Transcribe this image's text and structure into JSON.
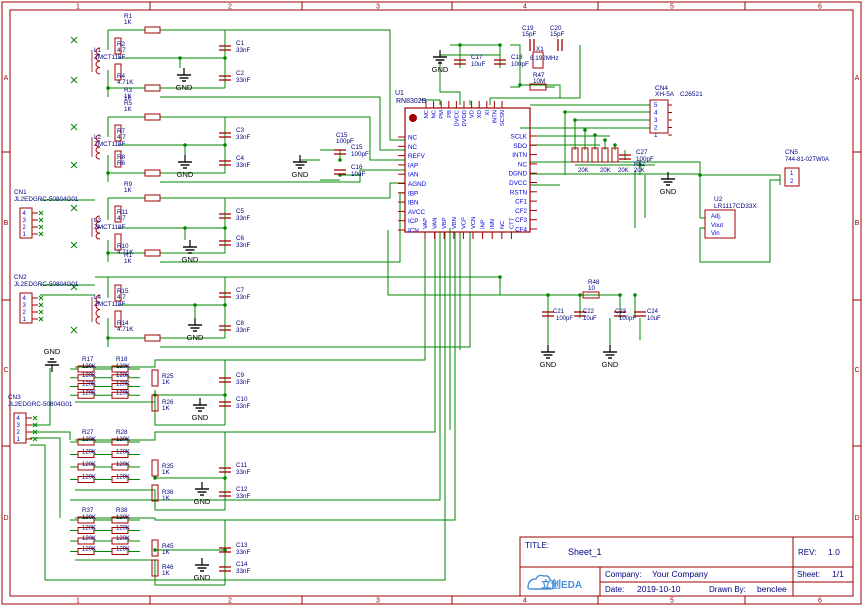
{
  "frame": {
    "cols": [
      "1",
      "2",
      "3",
      "4",
      "5",
      "6"
    ],
    "rows": [
      "A",
      "B",
      "C",
      "D"
    ],
    "border_color": "#990000",
    "wire_color": "#008800",
    "part_color": "#a00000",
    "text_color": "#000080",
    "pin_text_color": "#0000dd"
  },
  "title_block": {
    "title_label": "TITLE:",
    "title": "Sheet_1",
    "rev_label": "REV:",
    "rev": "1.0",
    "company_label": "Company:",
    "company": "Your Company",
    "sheet_label": "Sheet:",
    "sheet": "1/1",
    "date_label": "Date:",
    "date": "2019-10-10",
    "drawn_label": "Drawn By:",
    "drawn_by": "benclee",
    "logo_text": "立创EDA"
  },
  "u1": {
    "ref": "U1",
    "part": "RN8302B",
    "top_pins": [
      "NC",
      "NC",
      "PM",
      "PB",
      "DVCC",
      "DVDD",
      "VD",
      "XO",
      "XI",
      "INTN",
      "SCSN"
    ],
    "left_pins": [
      "NC",
      "NC",
      "REFV",
      "IAP",
      "IAN",
      "AGND",
      "IBP",
      "IBN",
      "AVCC",
      "ICP",
      "ICN"
    ],
    "right_pins": [
      "SCLK",
      "SDO",
      "INTN",
      "NC",
      "DGND",
      "DVCC",
      "RSTN",
      "CF1",
      "CF2",
      "CF3",
      "CF4"
    ],
    "bottom_pins": [
      "VAP",
      "VAN",
      "VBP",
      "VBN",
      "VCP",
      "VCN",
      "INP",
      "INN",
      "NC",
      "CTT"
    ]
  },
  "labels": {
    "r1": [
      "R1",
      "1K"
    ],
    "r2": [
      "R2",
      "4.7"
    ],
    "r4": [
      "R4",
      "R2"
    ],
    "r4v": [
      "4.71K"
    ],
    "r3": [
      "R3",
      "1K"
    ],
    "l1": [
      "L1",
      "ZMCT118F"
    ],
    "c1": [
      "C1",
      "33nF"
    ],
    "c2": [
      "C2",
      "33nF"
    ],
    "r5": [
      "R5",
      "1K"
    ],
    "r7": [
      "R7",
      "4.7"
    ],
    "r6": [
      "R6",
      "1K"
    ],
    "r8": [
      "R8",
      "4.7"
    ],
    "l2": [
      "L2",
      "ZMCT118F"
    ],
    "c3": [
      "C3",
      "33nF"
    ],
    "c4": [
      "C4",
      "33nF"
    ],
    "r9": [
      "R9",
      "1K"
    ],
    "r11": [
      "R11",
      "4.7"
    ],
    "r10": [
      "R10",
      "R12"
    ],
    "r12": [
      "4.71K"
    ],
    "l3": [
      "L3",
      "ZMCT118F"
    ],
    "c5": [
      "C5",
      "33nF"
    ],
    "c6": [
      "C6",
      "33nF"
    ],
    "r13": [
      "R1",
      "1K"
    ],
    "r15": [
      "R15",
      "4.7"
    ],
    "r14": [
      "R14",
      "R16"
    ],
    "r16": [
      "4.71K"
    ],
    "l4": [
      "L4",
      "ZMCT118F"
    ],
    "c7": [
      "C7",
      "33nF"
    ],
    "c8": [
      "C8",
      "33nF"
    ],
    "cn1": [
      "CN1",
      "JL2EDGRC-50804G01"
    ],
    "cn2": [
      "CN2",
      "JL2EDGRC-50804G01"
    ],
    "cn3": [
      "CN3",
      "JL2EDGRC-50804G01"
    ],
    "cn4": [
      "CN4",
      "XH-5A",
      "C26521"
    ],
    "cn5": [
      "CN5",
      "744-81-02TW0A"
    ],
    "u2": [
      "U2",
      "LR1117CD33X",
      "Adj.",
      "Vout",
      "Vin"
    ],
    "c15": [
      "C15",
      "100pF"
    ],
    "c16": [
      "C16",
      "10uF"
    ],
    "c17": [
      "C17",
      "10uF"
    ],
    "c18": [
      "C18",
      "100pF"
    ],
    "c19": [
      "C19",
      "15pF"
    ],
    "c20": [
      "C20",
      "15pF"
    ],
    "x1": [
      "X1",
      "8.192MHz"
    ],
    "r47": [
      "R47",
      "10M"
    ],
    "r48": [
      "R48",
      "10"
    ],
    "c21": [
      "C21",
      "100pF"
    ],
    "c22": [
      "C22",
      "10uF"
    ],
    "c23": [
      "C23",
      "100pF"
    ],
    "c24": [
      "C24",
      "10uF"
    ],
    "c27": [
      "C27",
      "100pF"
    ],
    "r49": [
      "R49",
      "20K"
    ],
    "r50": [
      "R50",
      "20K"
    ],
    "r51": [
      "20K"
    ],
    "r52": [
      "R52",
      "20K"
    ],
    "r17": [
      "R17",
      "120K"
    ],
    "r18": [
      "R18",
      "120K"
    ],
    "r27": [
      "R27",
      "120K"
    ],
    "r28": [
      "R28",
      "120K"
    ],
    "r37": [
      "R37",
      "120K"
    ],
    "r38": [
      "R38",
      "120K"
    ],
    "r25": [
      "R25",
      "1K"
    ],
    "r26": [
      "R26",
      "1K"
    ],
    "c9": [
      "C9",
      "33nF"
    ],
    "c10": [
      "C10",
      "33nF"
    ],
    "r35": [
      "R35",
      "1K"
    ],
    "r36": [
      "R36",
      "1K"
    ],
    "c11": [
      "C11",
      "33nF"
    ],
    "c12": [
      "C12",
      "33nF"
    ],
    "r45": [
      "R45",
      "1K"
    ],
    "r46": [
      "R46",
      "1K"
    ],
    "c13": [
      "C13",
      "33nF"
    ],
    "c14": [
      "C14",
      "33nF"
    ],
    "res120": "120K",
    "gnd": "GND",
    "cn_pins": [
      "4",
      "3",
      "2",
      "1"
    ],
    "cn5_pins": [
      "1",
      "2"
    ],
    "cn4_pins": [
      "5",
      "4",
      "3",
      "2",
      "1"
    ]
  }
}
